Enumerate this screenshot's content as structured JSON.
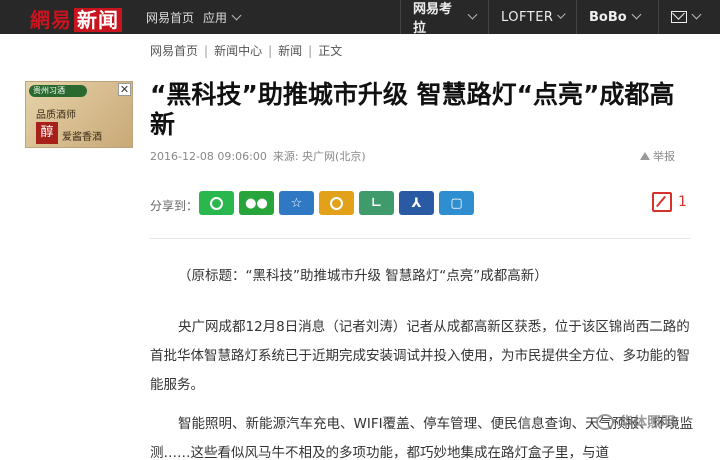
{
  "topbar": {
    "logo_main": "網易",
    "logo_news": "新闻",
    "nav_home": "网易首页",
    "nav_apps": "应用",
    "kaola": "网易考拉",
    "lofter": "LOFTER",
    "bobo": "BoBo"
  },
  "breadcrumb": [
    "网易首页",
    "新闻中心",
    "新闻",
    "正文"
  ],
  "ad": {
    "brand": "贵州习酒",
    "line1": "品质酒师",
    "seal": "醇",
    "line2": "爱酱香酒"
  },
  "article": {
    "title": "“黑科技”助推城市升级 智慧路灯“点亮”成都高新",
    "datetime": "2016-12-08 09:06:00",
    "source": "来源: 央广网(北京)",
    "report": "举报",
    "share_label": "分享到：",
    "comment_count": "1",
    "p1": "（原标题：“黑科技”助推城市升级 智慧路灯“点亮”成都高新）",
    "p2": "央广网成都12月8日消息（记者刘涛）记者从成都高新区获悉，位于该区锦尚西二路的首批华体智慧路灯系统已于近期完成安装调试并投入使用，为市民提供全方位、多功能的智能服务。",
    "p3": "智能照明、新能源汽车充电、WIFI覆盖、停车管理、便民信息查询、天气预报、环境监测……这些看似风马牛不相及的多项功能，都巧妙地集成在路灯盒子里，与道"
  },
  "share_icons": [
    "qq-icon",
    "wechat-icon",
    "qzone-icon",
    "weibo-icon",
    "yixin-icon",
    "renren-icon",
    "youdao-icon"
  ],
  "watermark": "华体照明",
  "colors": {
    "brand_red": "#c8141e",
    "topbar_bg": "#282828",
    "comment_red": "#d6312b"
  }
}
